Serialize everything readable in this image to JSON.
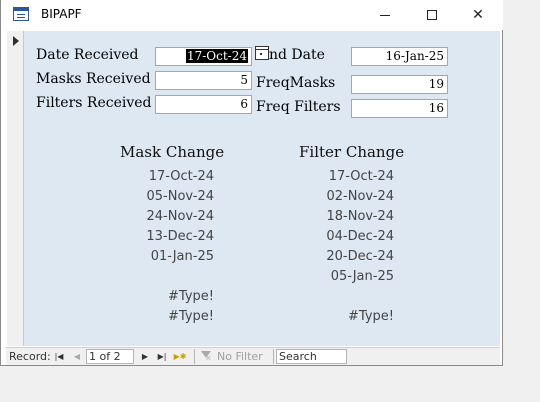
{
  "window": {
    "title": "BIPAPF"
  },
  "form": {
    "date_received": {
      "label": "Date Received",
      "value": "17-Oct-24"
    },
    "masks_received": {
      "label": "Masks Received",
      "value": "5"
    },
    "filters_received": {
      "label": "Filters Received",
      "value": "6"
    },
    "end_date": {
      "label": "nd Date",
      "value": "16-Jan-25"
    },
    "freq_masks": {
      "label": "FreqMasks",
      "value": "19"
    },
    "freq_filters": {
      "label": "Freq Filters",
      "value": "16"
    }
  },
  "mask_change": {
    "heading": "Mask Change",
    "dates": [
      "17-Oct-24",
      "05-Nov-24",
      "24-Nov-24",
      "13-Dec-24",
      "01-Jan-25",
      "",
      "#Type!",
      "#Type!"
    ]
  },
  "filter_change": {
    "heading": "Filter Change",
    "dates": [
      "17-Oct-24",
      "02-Nov-24",
      "18-Nov-24",
      "04-Dec-24",
      "20-Dec-24",
      "05-Jan-25",
      "",
      "#Type!"
    ]
  },
  "navigation": {
    "record_label": "Record:",
    "record_position": "1 of 2",
    "no_filter_label": "No Filter",
    "search_placeholder": "Search"
  }
}
